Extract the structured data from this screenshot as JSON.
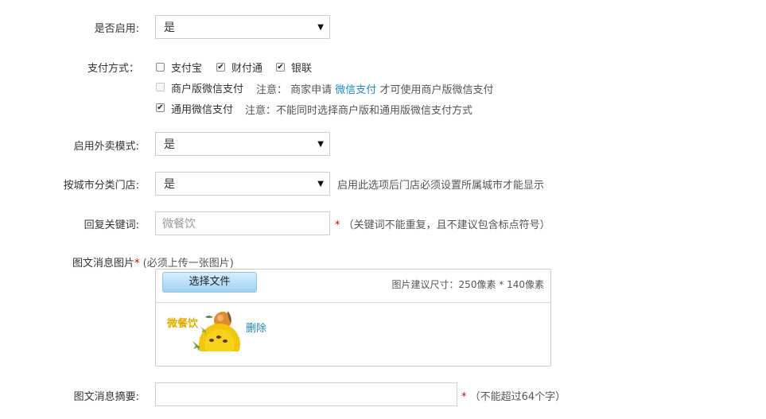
{
  "enabled": {
    "label": "是否启用:",
    "value": "是"
  },
  "payment": {
    "label": "支付方式：",
    "options": [
      {
        "label": "支付宝",
        "checked": false
      },
      {
        "label": "财付通",
        "checked": true
      },
      {
        "label": "银联",
        "checked": true
      }
    ],
    "merchant_wechat": {
      "label": "商户版微信支付",
      "checked": false,
      "note_prefix": "注意： 商家申请",
      "note_link": "微信支付",
      "note_suffix": "才可使用商户版微信支付"
    },
    "general_wechat": {
      "label": "通用微信支付",
      "checked": true,
      "note": "注意：不能同时选择商户版和通用版微信支付方式"
    }
  },
  "takeout": {
    "label": "启用外卖模式:",
    "value": "是"
  },
  "city_category": {
    "label": "按城市分类门店:",
    "value": "是",
    "hint": "启用此选项后门店必须设置所属城市才能显示"
  },
  "keyword": {
    "label": "回复关键词:",
    "placeholder": "微餐饮",
    "required_mark": "*",
    "hint": "（关键词不能重复，且不建议包含标点符号）"
  },
  "image": {
    "label": "图文消息图片",
    "required_mark": "*",
    "required_hint": "(必须上传一张图片)",
    "choose_button": "选择文件",
    "size_hint": "图片建议尺寸：250像素 * 140像素",
    "thumb_text": "微餐饮",
    "delete_label": "删除"
  },
  "summary": {
    "label": "图文消息摘要:",
    "value": "",
    "required_mark": "*",
    "hint": "（不能超过64个字）"
  },
  "colors": {
    "link": "#1a8ccb",
    "required": "#cc0000",
    "border": "#cccccc"
  },
  "icons": {
    "select_caret": "caret-down-icon",
    "checkbox_check": "check-icon"
  }
}
